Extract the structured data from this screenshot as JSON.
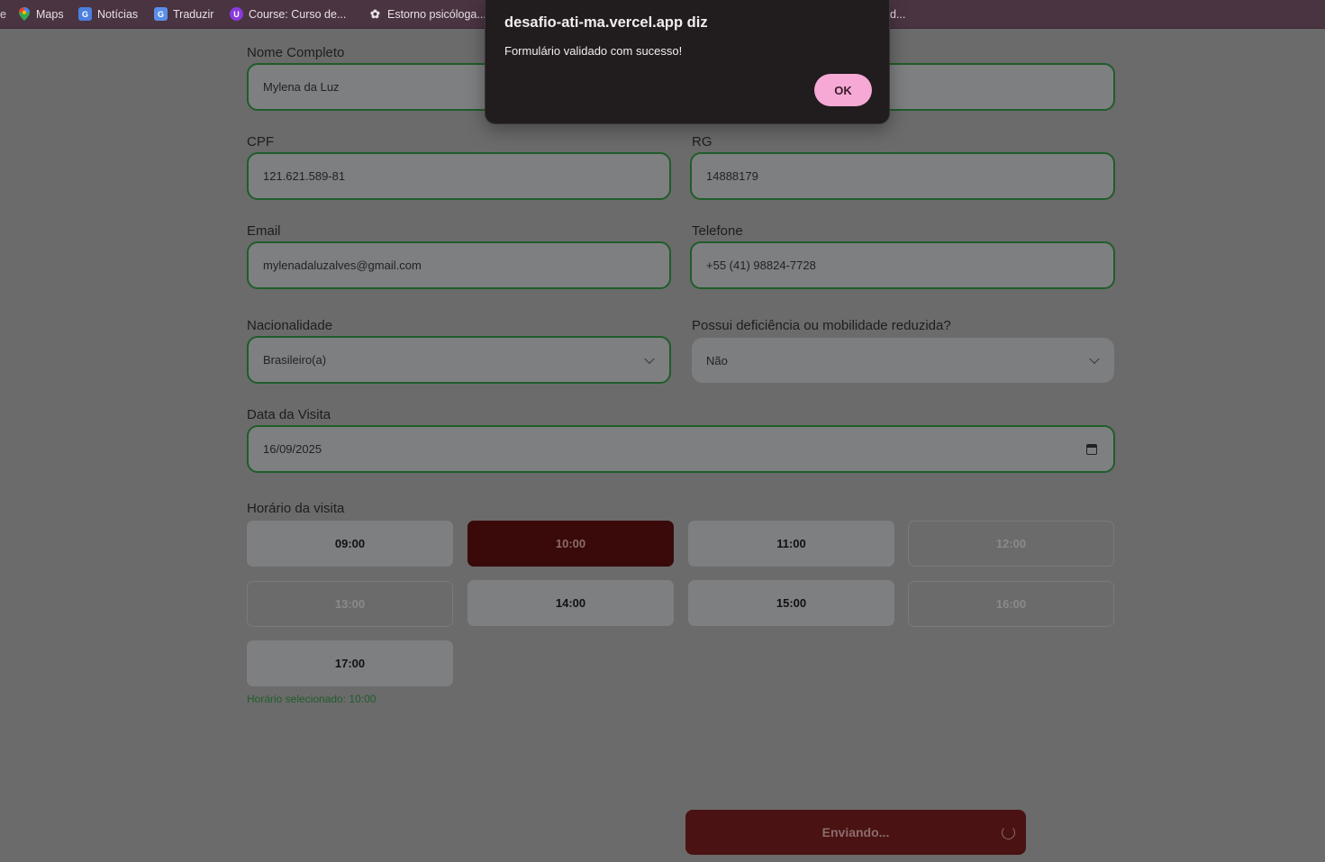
{
  "bookmarks": [
    {
      "label": "Maps",
      "icon": "maps-pin-icon"
    },
    {
      "label": "Notícias",
      "icon": "news-icon"
    },
    {
      "label": "Traduzir",
      "icon": "translate-icon"
    },
    {
      "label": "Course: Curso de...",
      "icon": "course-icon"
    },
    {
      "label": "Estorno psicóloga...",
      "icon": "openai-icon"
    },
    {
      "label": "d...",
      "icon": ""
    }
  ],
  "form": {
    "nome": {
      "label": "Nome Completo",
      "value": "Mylena da Luz"
    },
    "cpf": {
      "label": "CPF",
      "value": "121.621.589-81"
    },
    "rg": {
      "label": "RG",
      "value": "14888179"
    },
    "email": {
      "label": "Email",
      "value": "mylenadaluzalves@gmail.com"
    },
    "telefone": {
      "label": "Telefone",
      "value": "+55 (41) 98824-7728"
    },
    "nacionalidade": {
      "label": "Nacionalidade",
      "value": "Brasileiro(a)"
    },
    "deficiencia": {
      "label": "Possui deficiência ou mobilidade reduzida?",
      "value": "Não"
    },
    "data": {
      "label": "Data da Visita",
      "value": "16/09/2025"
    },
    "horario_label": "Horário da visita",
    "slots": [
      "09:00",
      "10:00",
      "11:00",
      "12:00",
      "13:00",
      "14:00",
      "15:00",
      "16:00",
      "17:00"
    ],
    "selected_slot": "10:00",
    "unavailable_slots": [
      "12:00",
      "13:00",
      "16:00"
    ],
    "selected_text": "Horário selecionado: 10:00",
    "submit_label": "Enviando..."
  },
  "dialog": {
    "title": "desafio-ati-ma.vercel.app diz",
    "message": "Formulário validado com sucesso!",
    "ok_label": "OK"
  },
  "colors": {
    "field_border": "#1f5d2a",
    "selected_slot_bg": "#3a0a0a",
    "ok_button_bg": "#f5a9d4",
    "bookmark_bar_bg": "#4a3442"
  }
}
